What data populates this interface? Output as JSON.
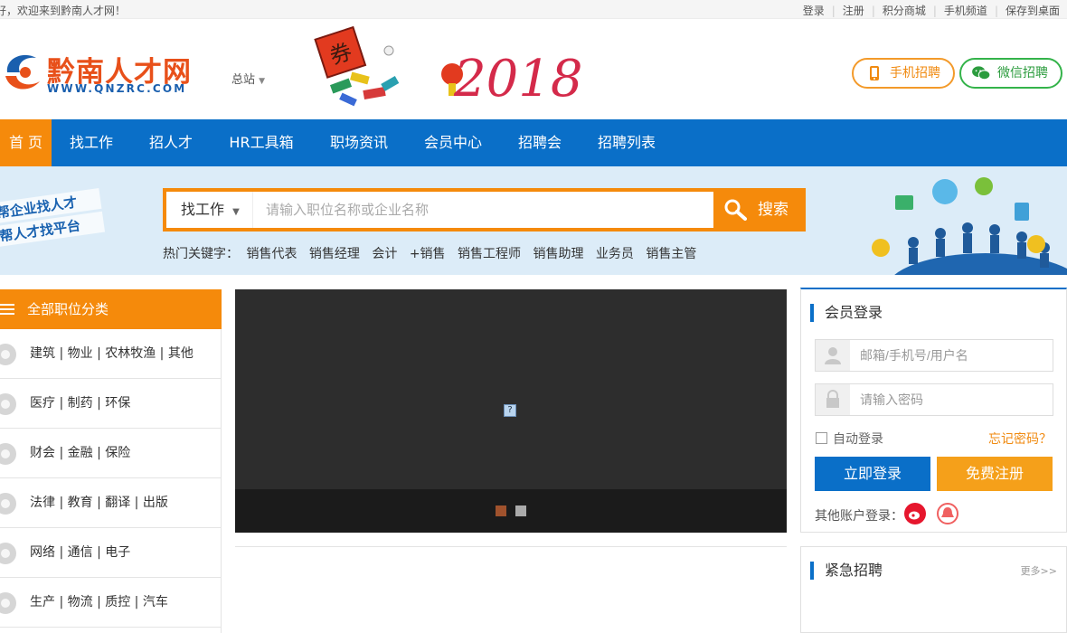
{
  "topbar": {
    "welcome": "好，欢迎来到黔南人才网！",
    "links": [
      "登录",
      "注册",
      "积分商城",
      "手机频道",
      "保存到桌面"
    ]
  },
  "header": {
    "logo_text": "黔南人才网",
    "logo_url": "WWW.QNZRC.COM",
    "site_switch": "总站",
    "banner_text": "2018",
    "banner_badge": "券",
    "mobile_button": "手机招聘",
    "wechat_button": "微信招聘"
  },
  "nav": {
    "items": [
      "首 页",
      "找工作",
      "招人才",
      "HR工具箱",
      "职场资讯",
      "会员中心",
      "招聘会",
      "招聘列表"
    ]
  },
  "search": {
    "slogan_lines": [
      "帮企业找人才",
      "帮人才找平台"
    ],
    "type": "找工作",
    "placeholder": "请输入职位名称或企业名称",
    "button": "搜索",
    "hot_label": "热门关键字：",
    "hot_keywords": [
      "销售代表",
      "销售经理",
      "会计",
      "+销售",
      "销售工程师",
      "销售助理",
      "业务员",
      "销售主管"
    ]
  },
  "categories": {
    "title": "全部职位分类",
    "items": [
      "建筑 | 物业 | 农林牧渔 | 其他",
      "医疗 | 制药 | 环保",
      "财会 | 金融 | 保险",
      "法律 | 教育 | 翻译 | 出版",
      "网络 | 通信 | 电子",
      "生产 | 物流 | 质控 | 汽车"
    ]
  },
  "slider": {
    "broken_glyph": "?",
    "dot_colors": [
      "#a0522d",
      "#aaaaaa"
    ]
  },
  "login": {
    "title": "会员登录",
    "username_placeholder": "邮箱/手机号/用户名",
    "password_placeholder": "请输入密码",
    "auto_login": "自动登录",
    "forgot": "忘记密码？",
    "login_button": "立即登录",
    "register_button": "免费注册",
    "other_label": "其他账户登录："
  },
  "urgent": {
    "title": "紧急招聘",
    "more": "更多>>"
  },
  "colors": {
    "brand_blue": "#0a6fc8",
    "accent_orange": "#f58a0b",
    "wechat_green": "#34b34a"
  }
}
